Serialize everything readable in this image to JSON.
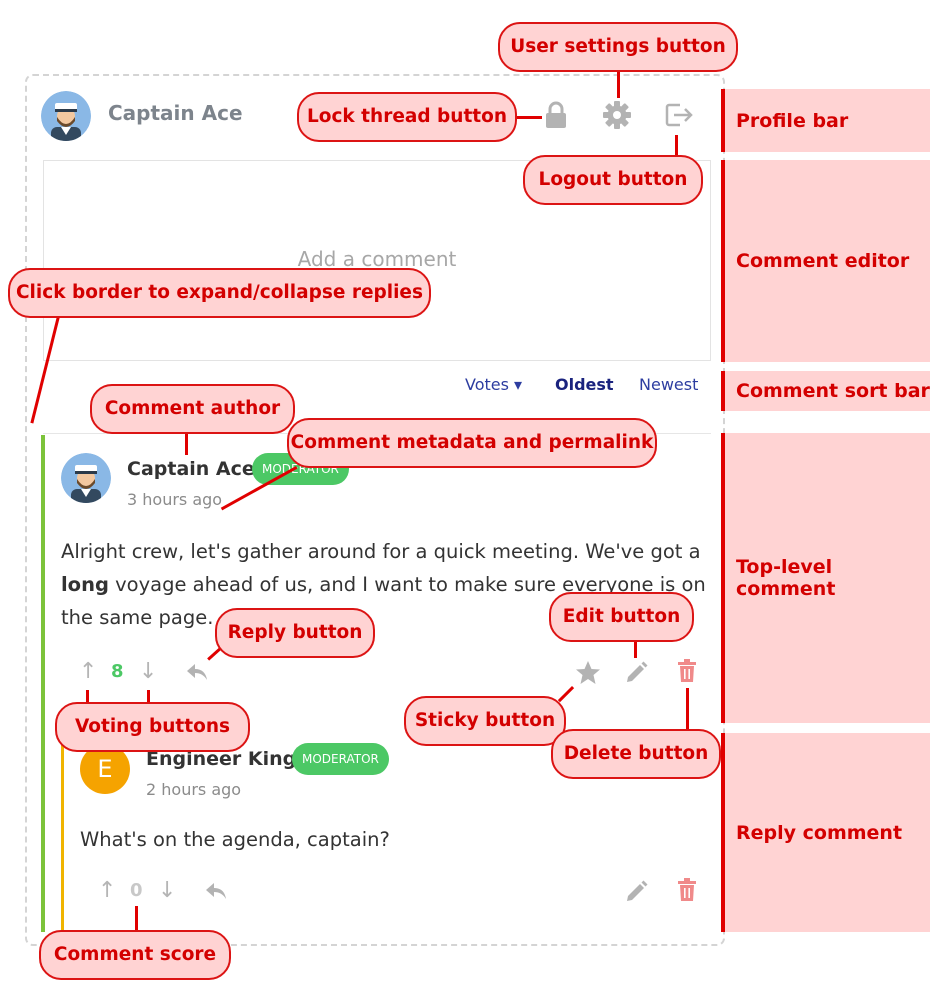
{
  "profile_bar": {
    "username": "Captain Ace"
  },
  "editor": {
    "placeholder": "Add a comment"
  },
  "sort_bar": {
    "votes_label": "Votes ▾",
    "oldest_label": "Oldest",
    "newest_label": "Newest",
    "active": "Oldest"
  },
  "top_comment": {
    "author": "Captain Ace",
    "badge": "MODERATOR",
    "time": "3 hours ago",
    "text_line1": "Alright crew, let's gather around for a quick meeting. We've got a",
    "text_bold": "long",
    "text_line2_rest": " voyage ahead of us, and I want to make sure everyone is on",
    "text_line3": "the same page.",
    "score": "8",
    "icons": [
      "upvote-icon",
      "downvote-icon",
      "reply-icon",
      "star-icon",
      "pencil-icon",
      "trash-icon"
    ]
  },
  "reply_comment": {
    "avatar_letter": "E",
    "author": "Engineer King",
    "badge": "MODERATOR",
    "time": "2 hours ago",
    "text": "What's on the agenda, captain?",
    "score": "0"
  },
  "annotations": {
    "user_settings": "User settings button",
    "lock_thread": "Lock thread button",
    "logout": "Logout button",
    "expand_collapse": "Click border to expand/collapse replies",
    "comment_author": "Comment author",
    "metadata_permalink": "Comment metadata and permalink",
    "reply_button": "Reply button",
    "edit_button": "Edit button",
    "voting_buttons": "Voting buttons",
    "sticky_button": "Sticky button",
    "delete_button": "Delete button",
    "comment_score": "Comment score"
  },
  "side_labels": {
    "profile_bar": "Profile bar",
    "comment_editor": "Comment editor",
    "comment_sort_bar": "Comment sort bar",
    "top_level_comment": "Top-level comment",
    "reply_comment": "Reply comment"
  },
  "colors": {
    "accent_blue": "#2d3da0",
    "moderator_green": "#4cc865",
    "top_thread_border": "#7cc33a",
    "reply_thread_border": "#f0b400",
    "score_positive": "#4cc865",
    "delete_red": "#f08a8a",
    "annotation_red": "#e00000",
    "annotation_fill": "#ffd3d3"
  }
}
